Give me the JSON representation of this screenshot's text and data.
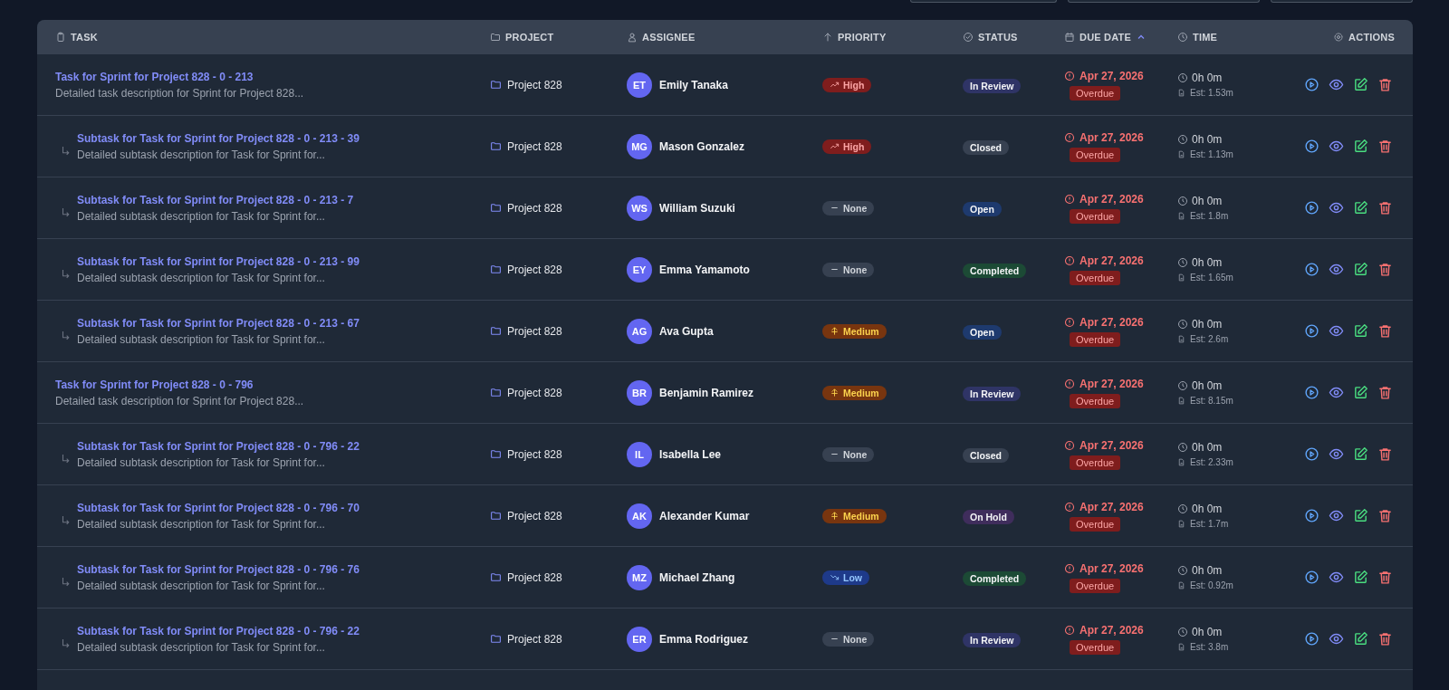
{
  "columns": [
    {
      "label": "TASK",
      "sorted": false
    },
    {
      "label": "PROJECT",
      "sorted": false
    },
    {
      "label": "ASSIGNEE",
      "sorted": false
    },
    {
      "label": "PRIORITY",
      "sorted": false
    },
    {
      "label": "STATUS",
      "sorted": false
    },
    {
      "label": "DUE DATE",
      "sorted": true
    },
    {
      "label": "TIME",
      "sorted": false
    },
    {
      "label": "ACTIONS",
      "sorted": false
    }
  ],
  "tasks": [
    {
      "title": "Task for Sprint for Project 828 - 0 - 213",
      "description": "Detailed task description for Sprint for Project 828...",
      "project": "Project 828",
      "initials": "ET",
      "assignee": "Emily Tanaka",
      "priority": {
        "kind": "high",
        "label": "High"
      },
      "status": {
        "kind": "in_review",
        "label": "In Review"
      },
      "due": "Apr 27, 2026",
      "due_badge": "Overdue",
      "time": "0h 0m",
      "estimate": "Est: 1.53m",
      "children": [
        {
          "title": "Subtask for Task for Sprint for Project 828 - 0 - 213 - 39",
          "description": "Detailed subtask description for Task for Sprint for...",
          "project": "Project 828",
          "initials": "MG",
          "assignee": "Mason Gonzalez",
          "priority": {
            "kind": "high",
            "label": "High"
          },
          "status": {
            "kind": "closed",
            "label": "Closed"
          },
          "due": "Apr 27, 2026",
          "due_badge": "Overdue",
          "time": "0h 0m",
          "estimate": "Est: 1.13m"
        },
        {
          "title": "Subtask for Task for Sprint for Project 828 - 0 - 213 - 7",
          "description": "Detailed subtask description for Task for Sprint for...",
          "project": "Project 828",
          "initials": "WS",
          "assignee": "William Suzuki",
          "priority": {
            "kind": "none",
            "label": "None"
          },
          "status": {
            "kind": "open",
            "label": "Open"
          },
          "due": "Apr 27, 2026",
          "due_badge": "Overdue",
          "time": "0h 0m",
          "estimate": "Est: 1.8m"
        },
        {
          "title": "Subtask for Task for Sprint for Project 828 - 0 - 213 - 99",
          "description": "Detailed subtask description for Task for Sprint for...",
          "project": "Project 828",
          "initials": "EY",
          "assignee": "Emma Yamamoto",
          "priority": {
            "kind": "none",
            "label": "None"
          },
          "status": {
            "kind": "completed",
            "label": "Completed"
          },
          "due": "Apr 27, 2026",
          "due_badge": "Overdue",
          "time": "0h 0m",
          "estimate": "Est: 1.65m"
        },
        {
          "title": "Subtask for Task for Sprint for Project 828 - 0 - 213 - 67",
          "description": "Detailed subtask description for Task for Sprint for...",
          "project": "Project 828",
          "initials": "AG",
          "assignee": "Ava Gupta",
          "priority": {
            "kind": "medium",
            "label": "Medium"
          },
          "status": {
            "kind": "open",
            "label": "Open"
          },
          "due": "Apr 27, 2026",
          "due_badge": "Overdue",
          "time": "0h 0m",
          "estimate": "Est: 2.6m"
        }
      ]
    },
    {
      "title": "Task for Sprint for Project 828 - 0 - 796",
      "description": "Detailed task description for Sprint for Project 828...",
      "project": "Project 828",
      "initials": "BR",
      "assignee": "Benjamin Ramirez",
      "priority": {
        "kind": "medium",
        "label": "Medium"
      },
      "status": {
        "kind": "in_review",
        "label": "In Review"
      },
      "due": "Apr 27, 2026",
      "due_badge": "Overdue",
      "time": "0h 0m",
      "estimate": "Est: 8.15m",
      "children": [
        {
          "title": "Subtask for Task for Sprint for Project 828 - 0 - 796 - 22",
          "description": "Detailed subtask description for Task for Sprint for...",
          "project": "Project 828",
          "initials": "IL",
          "assignee": "Isabella Lee",
          "priority": {
            "kind": "none",
            "label": "None"
          },
          "status": {
            "kind": "closed",
            "label": "Closed"
          },
          "due": "Apr 27, 2026",
          "due_badge": "Overdue",
          "time": "0h 0m",
          "estimate": "Est: 2.33m"
        },
        {
          "title": "Subtask for Task for Sprint for Project 828 - 0 - 796 - 70",
          "description": "Detailed subtask description for Task for Sprint for...",
          "project": "Project 828",
          "initials": "AK",
          "assignee": "Alexander Kumar",
          "priority": {
            "kind": "medium",
            "label": "Medium"
          },
          "status": {
            "kind": "on_hold",
            "label": "On Hold"
          },
          "due": "Apr 27, 2026",
          "due_badge": "Overdue",
          "time": "0h 0m",
          "estimate": "Est: 1.7m"
        },
        {
          "title": "Subtask for Task for Sprint for Project 828 - 0 - 796 - 76",
          "description": "Detailed subtask description for Task for Sprint for...",
          "project": "Project 828",
          "initials": "MZ",
          "assignee": "Michael Zhang",
          "priority": {
            "kind": "low",
            "label": "Low"
          },
          "status": {
            "kind": "completed",
            "label": "Completed"
          },
          "due": "Apr 27, 2026",
          "due_badge": "Overdue",
          "time": "0h 0m",
          "estimate": "Est: 0.92m"
        },
        {
          "title": "Subtask for Task for Sprint for Project 828 - 0 - 796 - 22",
          "description": "Detailed subtask description for Task for Sprint for...",
          "project": "Project 828",
          "initials": "ER",
          "assignee": "Emma Rodriguez",
          "priority": {
            "kind": "none",
            "label": "None"
          },
          "status": {
            "kind": "in_review",
            "label": "In Review"
          },
          "due": "Apr 27, 2026",
          "due_badge": "Overdue",
          "time": "0h 0m",
          "estimate": "Est: 3.8m"
        }
      ]
    }
  ]
}
